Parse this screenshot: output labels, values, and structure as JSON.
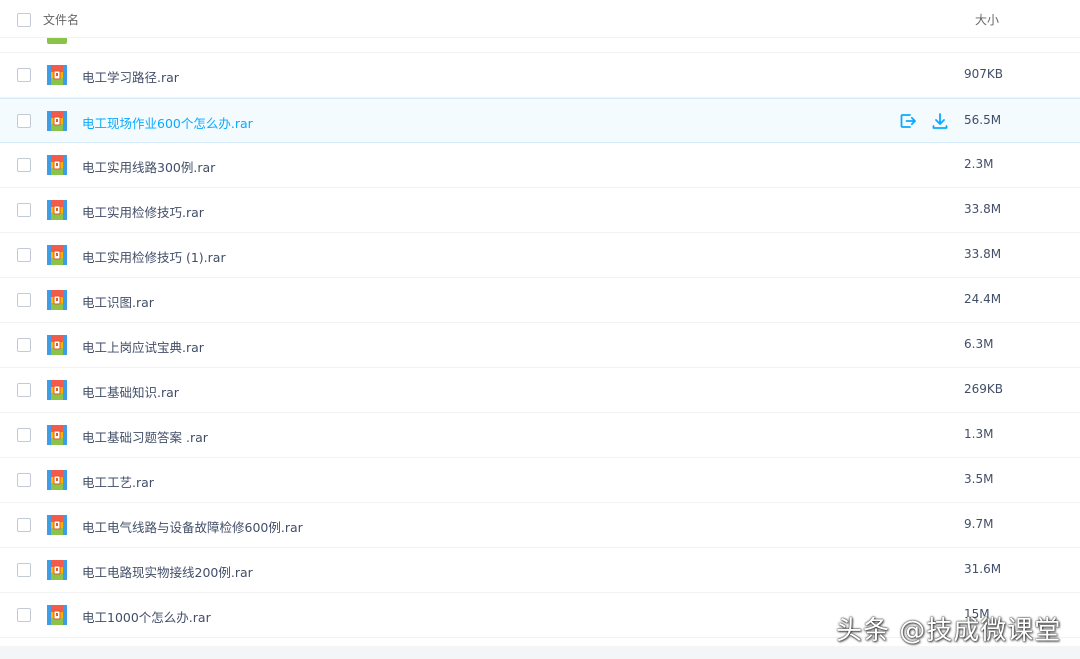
{
  "header": {
    "name_label": "文件名",
    "size_label": "大小"
  },
  "files": [
    {
      "name": "电工学习路径.rar",
      "size": "907KB"
    },
    {
      "name": "电工现场作业600个怎么办.rar",
      "size": "56.5M"
    },
    {
      "name": "电工实用线路300例.rar",
      "size": "2.3M"
    },
    {
      "name": "电工实用检修技巧.rar",
      "size": "33.8M"
    },
    {
      "name": "电工实用检修技巧 (1).rar",
      "size": "33.8M"
    },
    {
      "name": "电工识图.rar",
      "size": "24.4M"
    },
    {
      "name": "电工上岗应试宝典.rar",
      "size": "6.3M"
    },
    {
      "name": "电工基础知识.rar",
      "size": "269KB"
    },
    {
      "name": "电工基础习题答案 .rar",
      "size": "1.3M"
    },
    {
      "name": "电工工艺.rar",
      "size": "3.5M"
    },
    {
      "name": "电工电气线路与设备故障检修600例.rar",
      "size": "9.7M"
    },
    {
      "name": "电工电路现实物接线200例.rar",
      "size": "31.6M"
    },
    {
      "name": "电工1000个怎么办.rar",
      "size": "15M"
    }
  ],
  "hover_actions": [
    "share-icon",
    "download-icon"
  ],
  "colors": {
    "accent": "#09aaff",
    "text": "#424e67",
    "hover_bg": "#f4fbff"
  },
  "watermark": "头条 @技成微课堂"
}
